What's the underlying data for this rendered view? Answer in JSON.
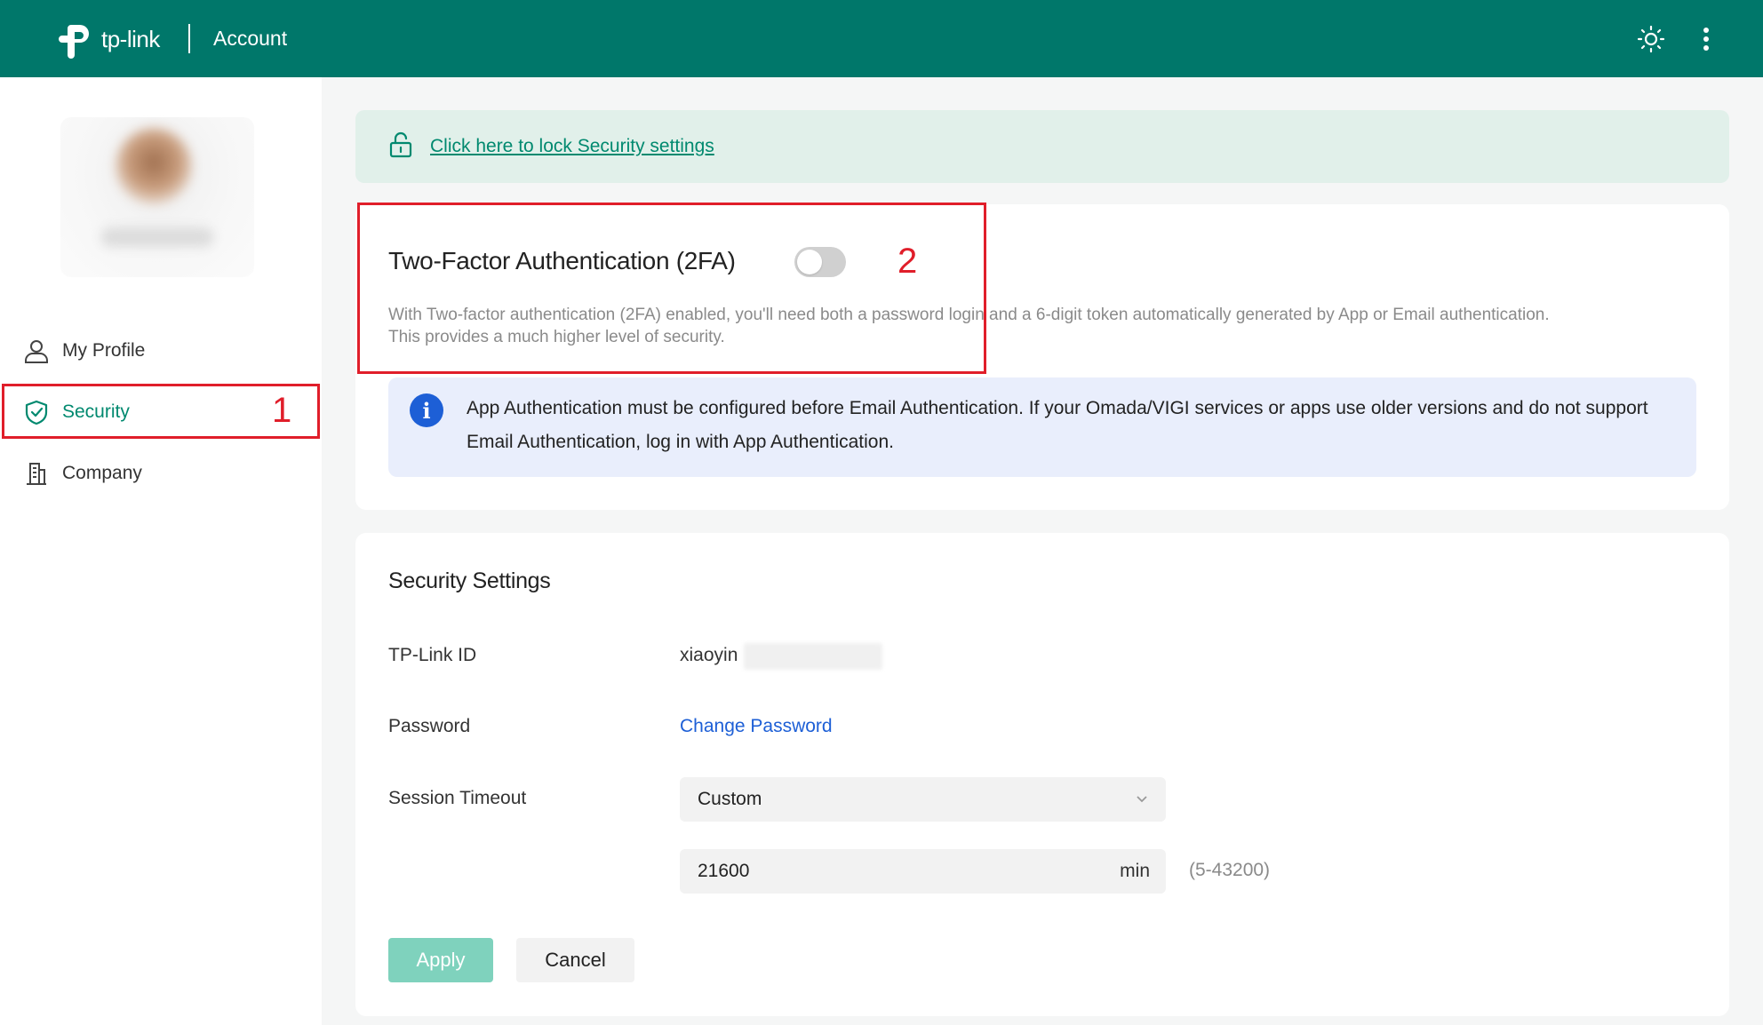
{
  "header": {
    "brand": "tp-link",
    "title": "Account",
    "icons": [
      "brightness-icon",
      "more-vertical-icon"
    ]
  },
  "sidebar": {
    "items": [
      {
        "label": "My Profile",
        "icon": "user-icon"
      },
      {
        "label": "Security",
        "icon": "shield-check-icon",
        "active": true
      },
      {
        "label": "Company",
        "icon": "building-icon"
      }
    ]
  },
  "annotations": {
    "marker_1": "1",
    "marker_2": "2",
    "color": "#e01e2a"
  },
  "lock_banner": {
    "link_text": "Click here to lock Security settings",
    "icon": "unlock-icon"
  },
  "two_factor": {
    "title": "Two-Factor Authentication (2FA)",
    "enabled": false,
    "description_line1": "With Two-factor authentication (2FA) enabled, you'll need both a password login and a 6-digit token automatically generated by App or Email authentication.",
    "description_line2": "This provides a much higher level of security.",
    "info": "App Authentication must be configured before Email Authentication. If your Omada/VIGI services or apps use older versions and do not support Email Authentication, log in with App Authentication."
  },
  "security_settings": {
    "title": "Security Settings",
    "tplink_id_label": "TP-Link ID",
    "tplink_id_value": "xiaoyin",
    "password_label": "Password",
    "change_password": "Change Password",
    "session_timeout_label": "Session Timeout",
    "session_timeout_selected": "Custom",
    "timeout_value": "21600",
    "timeout_unit": "min",
    "timeout_range": "(5-43200)",
    "apply": "Apply",
    "cancel": "Cancel"
  },
  "colors": {
    "header_bg": "#00776a",
    "accent": "#00896f",
    "link_blue": "#1d5fd6",
    "apply_disabled": "#7fd2bd"
  }
}
